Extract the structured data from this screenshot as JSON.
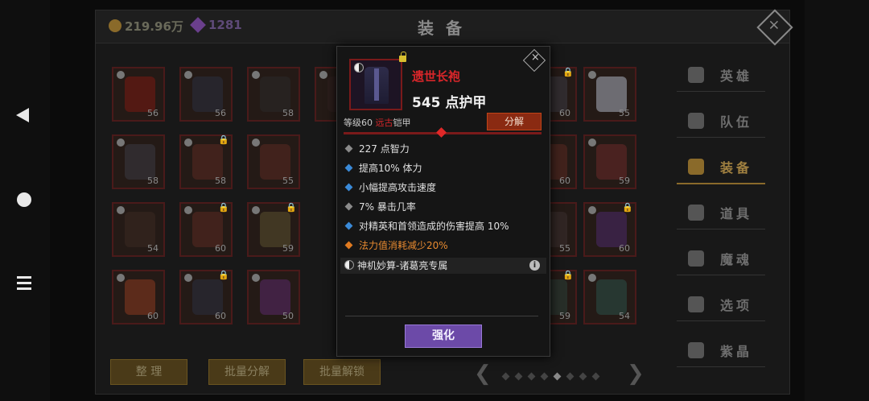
{
  "header": {
    "coins": "219.96万",
    "gems": "1281",
    "title": "装 备"
  },
  "grid": {
    "slots": [
      {
        "level": "56",
        "color": "#7a1a12",
        "locked": false
      },
      {
        "level": "56",
        "color": "#2a3040",
        "locked": false
      },
      {
        "level": "58",
        "color": "#2a2a2a",
        "locked": false
      },
      {
        "level": "",
        "color": "#302020",
        "locked": false
      },
      {
        "level": "58",
        "color": "#3a3a44",
        "locked": false
      },
      {
        "level": "58",
        "color": "#5a2a22",
        "locked": true
      },
      {
        "level": "55",
        "color": "#5a2a22",
        "locked": false
      },
      {
        "level": "54",
        "color": "#3a2a22",
        "locked": false
      },
      {
        "level": "60",
        "color": "#5a2a22",
        "locked": true
      },
      {
        "level": "59",
        "color": "#5a5030",
        "locked": true
      },
      {
        "level": "60",
        "color": "#8a3a20",
        "locked": false
      },
      {
        "level": "60",
        "color": "#2a3040",
        "locked": true
      },
      {
        "level": "50",
        "color": "#5a2a6a",
        "locked": false
      }
    ],
    "right_slots": [
      {
        "level": "60",
        "color": "#3a3a44",
        "locked": true
      },
      {
        "level": "55",
        "color": "#aab0c0",
        "locked": false
      },
      {
        "level": "60",
        "color": "#5a2a22",
        "locked": false
      },
      {
        "level": "59",
        "color": "#6a2a2a",
        "locked": false
      },
      {
        "level": "55",
        "color": "#3a3030",
        "locked": false
      },
      {
        "level": "60",
        "color": "#4a2a6a",
        "locked": true
      },
      {
        "level": "59",
        "color": "#2a4038",
        "locked": true
      },
      {
        "level": "54",
        "color": "#2a5048",
        "locked": false
      }
    ]
  },
  "side_tabs": [
    {
      "label": "英雄",
      "active": false
    },
    {
      "label": "队伍",
      "active": false
    },
    {
      "label": "装备",
      "active": true
    },
    {
      "label": "道具",
      "active": false
    },
    {
      "label": "魔魂",
      "active": false
    },
    {
      "label": "选项",
      "active": false
    },
    {
      "label": "紫晶",
      "active": false
    }
  ],
  "bottom": {
    "sort": "整 理",
    "bulk_dismantle": "批量分解",
    "bulk_unlock": "批量解锁",
    "arrow_left": "❮",
    "arrow_right": "❯"
  },
  "popup": {
    "name": "遗世长袍",
    "armor": "545 点护甲",
    "level_prefix": "等级60",
    "quality": "远古",
    "item_type": "铠甲",
    "dismantle": "分解",
    "stats": [
      {
        "text": "227 点智力",
        "color": "#8a8a8a"
      },
      {
        "text": "提高10% 体力",
        "color": "#3a8ad8"
      },
      {
        "text": "小幅提高攻击速度",
        "color": "#3a8ad8"
      },
      {
        "text": "7% 暴击几率",
        "color": "#8a8a8a"
      },
      {
        "text": "对精英和首领造成的伤害提高 10%",
        "color": "#3a8ad8"
      },
      {
        "text": "法力值消耗减少20%",
        "color": "#e07a20"
      }
    ],
    "set_name": "神机妙算-诸葛亮专属",
    "info": "i",
    "enhance": "强化",
    "close": "×"
  }
}
